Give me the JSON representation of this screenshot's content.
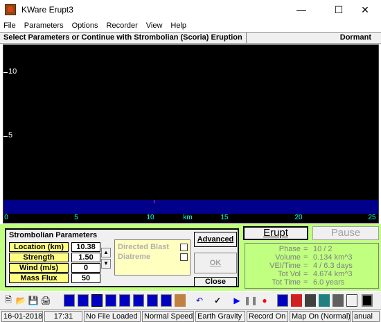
{
  "window": {
    "title": "KWare Erupt3"
  },
  "menu": [
    "File",
    "Parameters",
    "Options",
    "Recorder",
    "View",
    "Help"
  ],
  "header": {
    "message": "Select Parameters or Continue with Strombolian (Scoria) Eruption",
    "state": "Dormant"
  },
  "plot": {
    "y_ticks": [
      "10",
      "5"
    ],
    "x_ticks": [
      "0",
      "5",
      "10",
      "km",
      "15",
      "20",
      "25"
    ],
    "colors": {
      "sky": "#000000",
      "ground": "#00008b",
      "axis_text": "#00ffff",
      "vent": "#ff4040"
    }
  },
  "params": {
    "title": "Strombolian Parameters",
    "rows": [
      {
        "label": "Location (km)",
        "value": "10.38"
      },
      {
        "label": "Strength",
        "value": "1.50"
      },
      {
        "label": "Wind (m/s)",
        "value": "0"
      },
      {
        "label": "Mass Flux",
        "value": "50"
      }
    ],
    "options": [
      "Directed Blast",
      "Diatreme"
    ],
    "buttons": {
      "advanced": "Advanced",
      "ok": "OK",
      "close": "Close"
    }
  },
  "eruption": {
    "erupt_label": "Erupt",
    "pause_label": "Pause"
  },
  "stats": [
    {
      "label": "Phase",
      "value": "10 / 2"
    },
    {
      "label": "Volume",
      "value": "0.134 km^3"
    },
    {
      "label": "VEI/Time",
      "value": "4 / 6.3 days"
    },
    {
      "label": "Tot Vol",
      "value": "4.674 km^3"
    },
    {
      "label": "Tot Time",
      "value": "6.0 years"
    }
  ],
  "statusbar": [
    "16-01-2018",
    "17:31",
    "No File Loaded",
    "Normal Speed",
    "Earth Gravity",
    "Record On",
    "Map On (Normal)",
    "anual"
  ],
  "toolbar_icons": [
    "new-icon",
    "open-icon",
    "save-icon",
    "print-icon",
    "volcano-1-icon",
    "volcano-2-icon",
    "volcano-3-icon",
    "volcano-4-icon",
    "volcano-5-icon",
    "volcano-6-icon",
    "volcano-7-icon",
    "volcano-8-icon",
    "undo-icon",
    "check-icon",
    "play-icon",
    "pause-icon",
    "record-icon",
    "monitor-icon",
    "fire-icon",
    "film-icon",
    "image-icon",
    "photo-icon",
    "keyboard-icon",
    "display-icon"
  ]
}
